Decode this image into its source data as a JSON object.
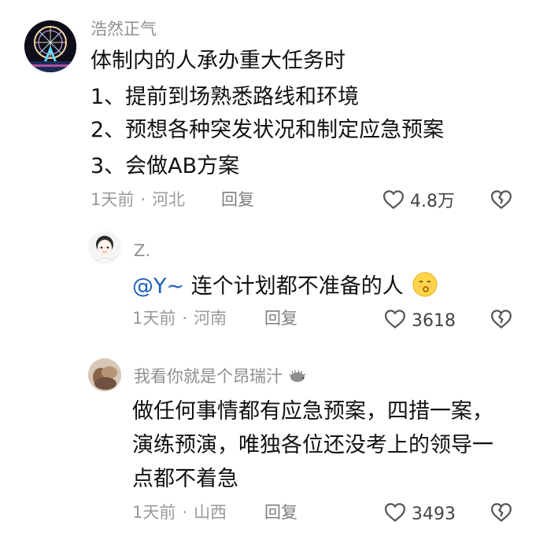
{
  "comments": [
    {
      "username": "浩然正气",
      "lines": [
        "体制内的人承办重大任务时",
        "1、提前到场熟悉路线和环境",
        "2、预想各种突发状况和制定应急预案",
        "3、会做AB方案"
      ],
      "time": "1天前",
      "location": "河北",
      "reply_label": "回复",
      "likes": "4.8万",
      "avatar_icon": "ferris-wheel-night-avatar"
    },
    {
      "username": "Z.",
      "mention": "@Y~",
      "text": " 连个计划都不准备的人",
      "emoji_name": "kissing-face-icon",
      "time": "1天前",
      "location": "河南",
      "reply_label": "回复",
      "likes": "3618",
      "avatar_icon": "cartoon-girl-avatar"
    },
    {
      "username": "我看你就是个昂瑞汁",
      "username_emoji": "hedgehog-icon",
      "lines": [
        "做任何事情都有应急预案，四措一案，",
        "演练预演，唯独各位还没考上的领导一",
        "点都不着急"
      ],
      "time": "1天前",
      "location": "山西",
      "reply_label": "回复",
      "likes": "3493",
      "avatar_icon": "photo-avatar"
    }
  ],
  "colors": {
    "meta": "#9a9a9a",
    "mention": "#1f5fb8",
    "icon": "#555555"
  }
}
